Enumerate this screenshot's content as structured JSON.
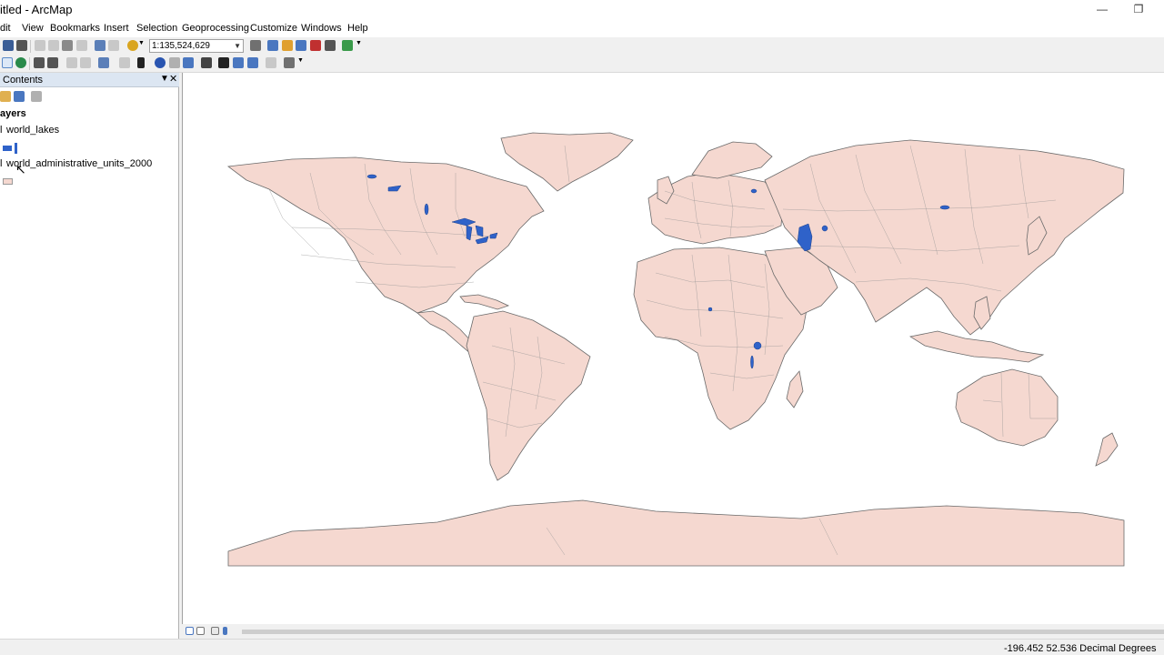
{
  "window": {
    "title": "itled - ArcMap",
    "minimize_icon": "minimize-icon",
    "restore_icon": "restore-icon"
  },
  "menu": [
    "dit",
    "View",
    "Bookmarks",
    "Insert",
    "Selection",
    "Geoprocessing",
    "Customize",
    "Windows",
    "Help"
  ],
  "toolbar": {
    "scale_value": "1:135,524,629"
  },
  "toc": {
    "title": "Contents",
    "pin_icon": "pin-icon",
    "close_icon": "close-icon",
    "root_label": "ayers",
    "layers": [
      {
        "checkbox": "l",
        "name": "world_lakes",
        "symbol_color": "#2f62c9"
      },
      {
        "checkbox": "l",
        "name": "world_administrative_units_2000",
        "symbol_color": "#f5d8d0"
      }
    ]
  },
  "map": {
    "land_color": "#f5d8d0",
    "lake_color": "#2f62c9",
    "outline_color": "#6a6a6a"
  },
  "status": {
    "coordinates": "-196.452  52.536 Decimal Degrees"
  }
}
